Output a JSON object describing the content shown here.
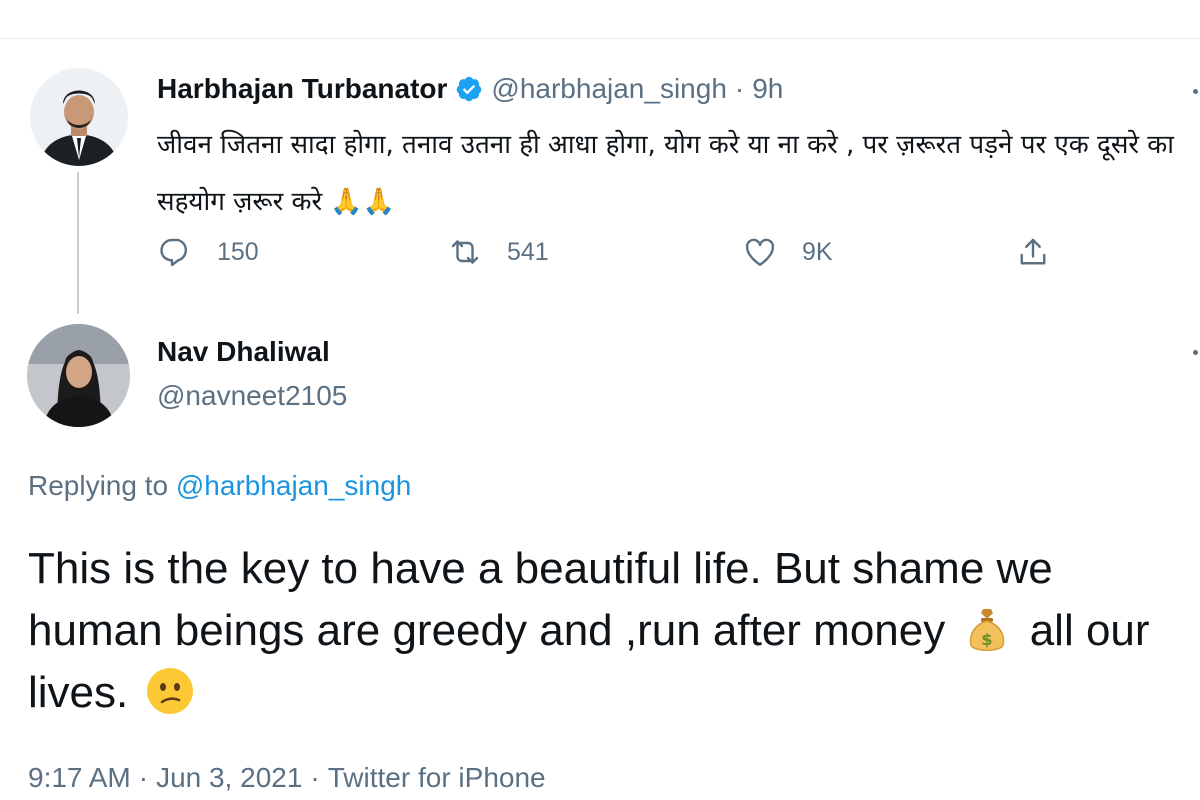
{
  "original_tweet": {
    "display_name": "Harbhajan Turbanator",
    "handle": "@harbhajan_singh",
    "separator": "·",
    "time_ago": "9h",
    "text": "जीवन जितना सादा होगा, तनाव उतना ही आधा होगा, योग करे या ना करे , पर ज़रूरत पड़ने पर एक दूसरे का सहयोग ज़रूर करे 🙏🙏",
    "reply_count": "150",
    "retweet_count": "541",
    "like_count": "9K",
    "icons": [
      "verified-badge-icon",
      "reply-icon",
      "retweet-icon",
      "like-icon",
      "share-icon",
      "more-options-icon"
    ]
  },
  "reply_tweet": {
    "display_name": "Nav Dhaliwal",
    "handle": "@navneet2105",
    "replying_prefix": "Replying to",
    "replying_to": "@harbhajan_singh",
    "text_part1": "This is the key to have a beautiful life. But shame we human beings are greedy and ,run after money",
    "text_part2": "all our lives.",
    "emojis": [
      "money-bag-emoji",
      "confused-face-emoji"
    ],
    "time": "9:17 AM",
    "separator": "·",
    "date": "Jun 3, 2021",
    "source": "Twitter for iPhone"
  },
  "colors": {
    "text_primary": "#0f1419",
    "text_secondary": "#5b7083",
    "link_blue": "#1b95e0",
    "verified_blue": "#1da1f2",
    "divider": "#e6ecf0"
  }
}
